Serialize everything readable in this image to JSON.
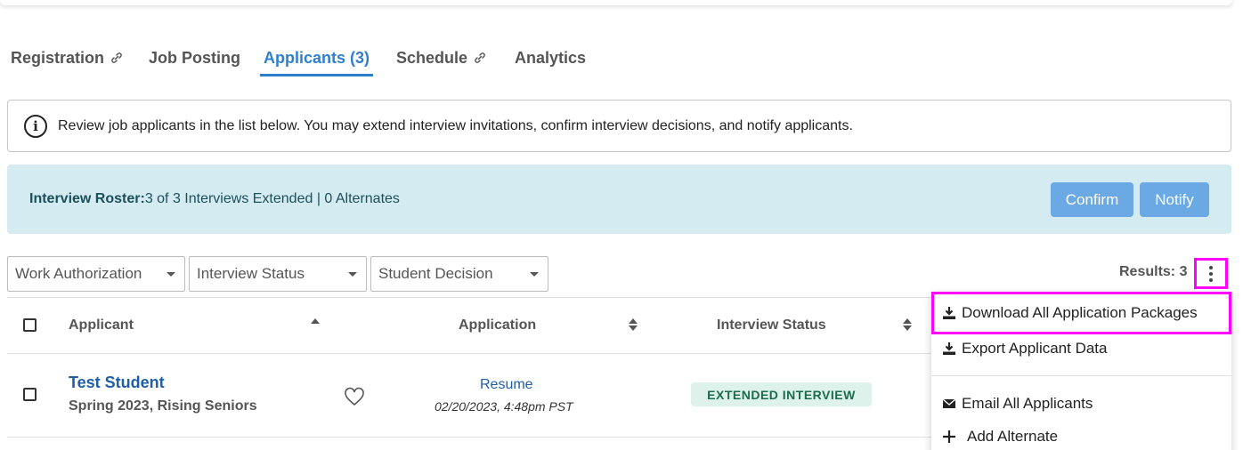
{
  "tabs": [
    {
      "label": "Registration",
      "linked": true
    },
    {
      "label": "Job Posting",
      "linked": false
    },
    {
      "label": "Applicants (3)",
      "linked": false,
      "active": true
    },
    {
      "label": "Schedule",
      "linked": true
    },
    {
      "label": "Analytics",
      "linked": false
    }
  ],
  "info": {
    "text": "Review job applicants in the list below. You may extend interview invitations, confirm interview decisions, and notify applicants."
  },
  "roster": {
    "label": "Interview Roster:",
    "value": "3 of 3 Interviews Extended | 0 Alternates",
    "confirm_label": "Confirm",
    "notify_label": "Notify"
  },
  "filters": {
    "work_authorization": "Work Authorization",
    "interview_status": "Interview Status",
    "student_decision": "Student Decision"
  },
  "results_label": "Results: 3",
  "table": {
    "headers": {
      "applicant": "Applicant",
      "application": "Application",
      "interview_status": "Interview Status"
    },
    "rows": [
      {
        "name": "Test Student",
        "subtitle": "Spring 2023, Rising Seniors",
        "application_link": "Resume",
        "application_date": "02/20/2023, 4:48pm PST",
        "status": "EXTENDED INTERVIEW"
      }
    ]
  },
  "menu": {
    "items": [
      {
        "label": "Download All Application Packages",
        "icon": "download-icon"
      },
      {
        "label": "Export Applicant Data",
        "icon": "download-icon"
      },
      {
        "label": "Email All Applicants",
        "icon": "envelope-icon"
      },
      {
        "label": "Add Alternate",
        "icon": "plus-icon"
      }
    ]
  },
  "colors": {
    "accent": "#2f7fd1",
    "roster_bg": "#d4ecf1",
    "button": "#6aa9e3",
    "badge_bg": "#dcf2ea",
    "highlight": "#ff00ff"
  }
}
